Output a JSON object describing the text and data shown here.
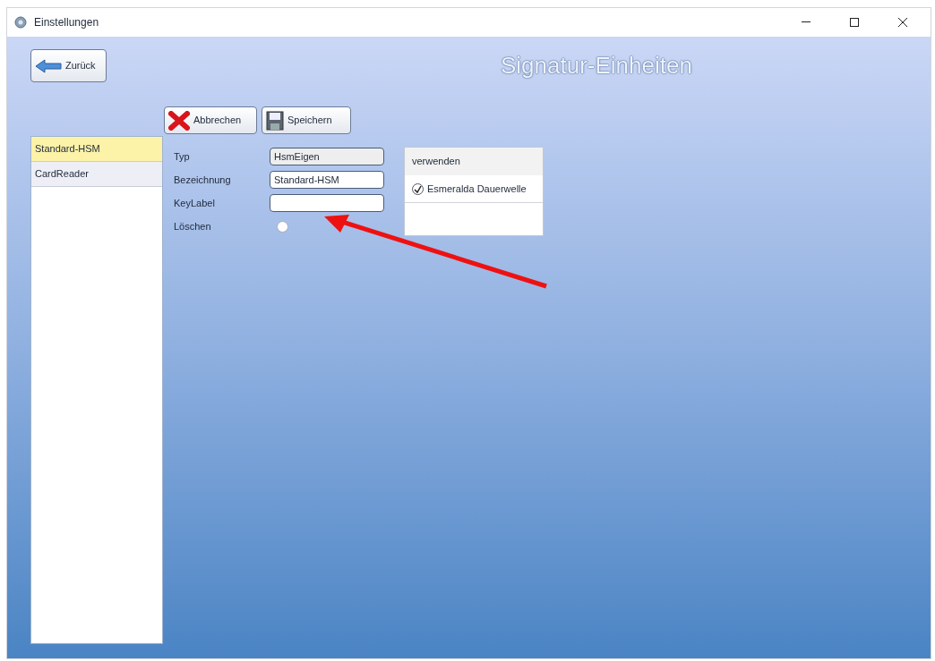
{
  "window": {
    "title": "Einstellungen"
  },
  "back_button": {
    "label": "Zurück"
  },
  "page_title": "Signatur-Einheiten",
  "toolbar": [
    {
      "kind": "cancel",
      "label": "Abbrechen"
    },
    {
      "kind": "save",
      "label": "Speichern"
    }
  ],
  "sidebar": {
    "items": [
      {
        "label": "Standard-HSM",
        "selected": true
      },
      {
        "label": "CardReader",
        "selected": false
      }
    ]
  },
  "form": [
    {
      "kind": "text",
      "label": "Typ",
      "value": "HsmEigen",
      "disabled": true
    },
    {
      "kind": "text",
      "label": "Bezeichnung",
      "value": "Standard-HSM",
      "disabled": false
    },
    {
      "kind": "text",
      "label": "KeyLabel",
      "disabled": false
    },
    {
      "kind": "checkbox",
      "label": "Löschen",
      "checked": false
    }
  ],
  "usage_panel": {
    "header": "verwenden",
    "items": [
      {
        "label": "Esmeralda Dauerwelle",
        "checked": true
      }
    ]
  }
}
